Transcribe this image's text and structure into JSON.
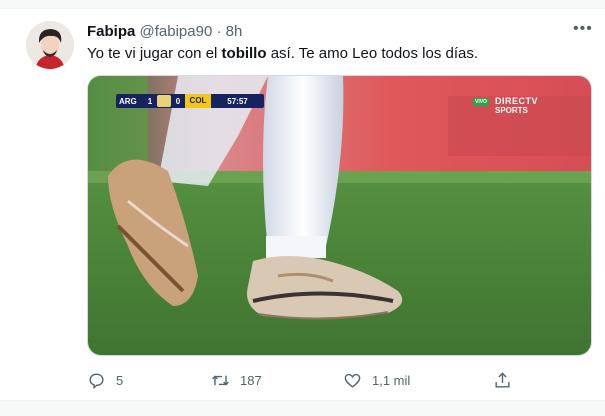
{
  "tweet": {
    "display_name": "Fabipa",
    "handle": "@fabipa90",
    "separator": "·",
    "time_ago": "8h",
    "text_before": "Yo te vi jugar con el ",
    "text_bold": "tobillo",
    "text_after": " así. Te amo Leo todos los días.",
    "more_label": "•••"
  },
  "media": {
    "scoreboard": {
      "home_team": "ARG",
      "home_score": "1",
      "away_score": "0",
      "away_team": "COL",
      "clock": "57:57"
    },
    "broadcaster": {
      "live_tag": "VIVO",
      "name_line1": "DIRECTV",
      "name_line2": "SPORTS"
    }
  },
  "actions": {
    "reply_count": "5",
    "retweet_count": "187",
    "like_count": "1,1 mil"
  },
  "colors": {
    "text_primary": "#0f1419",
    "text_secondary": "#536471",
    "pitch_green": "#4f8a3c",
    "ad_board_red": "#e0585a"
  },
  "icons": [
    "more-icon",
    "reply-icon",
    "retweet-icon",
    "like-icon",
    "share-icon"
  ]
}
